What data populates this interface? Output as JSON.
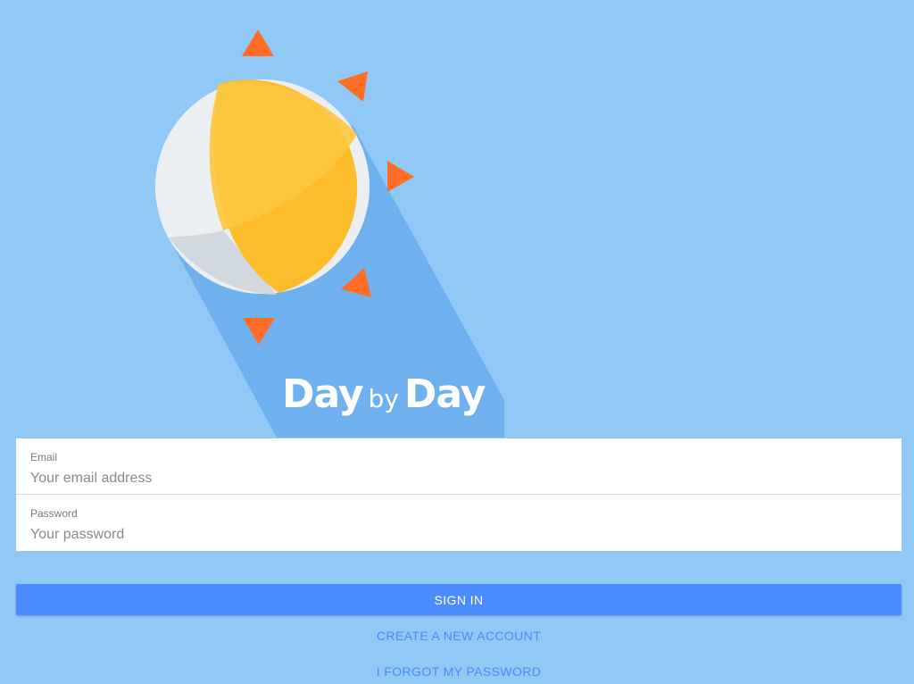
{
  "brand": {
    "word1": "Day",
    "word2": "by",
    "word3": "Day",
    "logo_icon": "sun-moon-icon",
    "colors": {
      "background": "#90c8f6",
      "shadow": "#6fb0ef",
      "sun": "#fbbd2b",
      "moon": "#eceff1",
      "rays": "#ff6d26"
    }
  },
  "login": {
    "email_label": "Email",
    "email_placeholder": "Your email address",
    "password_label": "Password",
    "password_placeholder": "Your password"
  },
  "actions": {
    "sign_in": "SIGN IN",
    "create_account": "CREATE A NEW ACCOUNT",
    "forgot_password": "I FORGOT MY PASSWORD",
    "accent_color": "#4a8cff"
  }
}
